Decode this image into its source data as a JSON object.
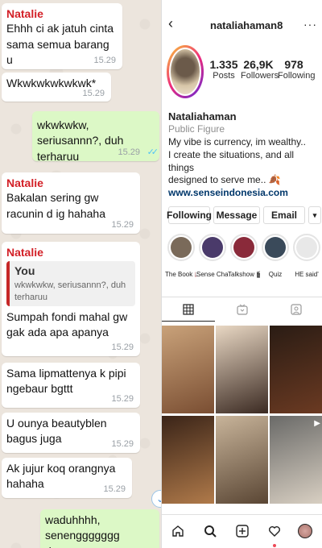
{
  "chat": {
    "messages": [
      {
        "sender": "Natalie",
        "text": "Ehhh ci ak jatuh cinta sama semua barang u",
        "time": "15.29"
      },
      {
        "text": "Wkwkwkwkwkwk*",
        "time": "15.29"
      },
      {
        "text": "wkwkwkw, seriusannn?, duh terharuu",
        "time": "15.29",
        "status": "read-ticks"
      },
      {
        "sender": "Natalie",
        "text": "Bakalan sering gw racunin d ig hahaha",
        "time": "15.29"
      },
      {
        "sender": "Natalie",
        "quote_name": "You",
        "quote_text": "wkwkwkw, seriusannn?, duh terharuu",
        "text": "Sumpah fondi mahal gw gak ada apa apanya",
        "time": "15.29"
      },
      {
        "text": "Sama lipmattenya k pipi ngebaur bgttt",
        "time": "15.29"
      },
      {
        "text": "U ounya beautyblen bagus juga",
        "time": "15.29"
      },
      {
        "text": "Ak jujur koq orangnya hahaha",
        "time": "15.29"
      },
      {
        "text": "waduhhhh, senenggggggg dengernyaaaa",
        "time": ""
      }
    ]
  },
  "instagram": {
    "username": "nataliahaman8",
    "stats": [
      {
        "value": "1.335",
        "label": "Posts"
      },
      {
        "value": "26,9K",
        "label": "Followers"
      },
      {
        "value": "978",
        "label": "Following"
      }
    ],
    "bio": {
      "name": "Nataliahaman",
      "category": "Public Figure",
      "lines": [
        "My vibe is currency, im wealthy..",
        "I create the situations, and all things",
        "designed to serve me.. 🍂"
      ],
      "link": "www.senseindonesia.com"
    },
    "buttons": {
      "following": "Following",
      "message": "Message",
      "email": "Email",
      "dropdown_icon": "chevron-down-icon"
    },
    "highlights": [
      {
        "label": "The Book 📖",
        "color": "#7a6a5a"
      },
      {
        "label": "Sense Chal...",
        "color": "#4a3a6a"
      },
      {
        "label": "Talkshow 🎬",
        "color": "#8a2a3a"
      },
      {
        "label": "Quiz",
        "color": "#3a4a5a"
      },
      {
        "label": "HE said'",
        "color": "#e8e8e8"
      }
    ],
    "tabs": [
      "grid-icon",
      "igtv-icon",
      "tagged-icon"
    ],
    "posts": [
      {
        "colors": [
          "#c9a27a",
          "#7a4e32"
        ]
      },
      {
        "colors": [
          "#e9d8c4",
          "#3b2a22"
        ]
      },
      {
        "colors": [
          "#2a1c14",
          "#6b3a22"
        ]
      },
      {
        "colors": [
          "#3a2418",
          "#b07a4a"
        ]
      },
      {
        "colors": [
          "#c8b49a",
          "#5a4634"
        ]
      },
      {
        "colors": [
          "#6a6a68",
          "#d8cfc2"
        ],
        "badge": "video-icon"
      }
    ],
    "nav": [
      "home-icon",
      "search-icon",
      "new-post-icon",
      "activity-icon",
      "profile-icon"
    ],
    "accent_link": "#00376b",
    "notification_dot": "#ed4956"
  }
}
